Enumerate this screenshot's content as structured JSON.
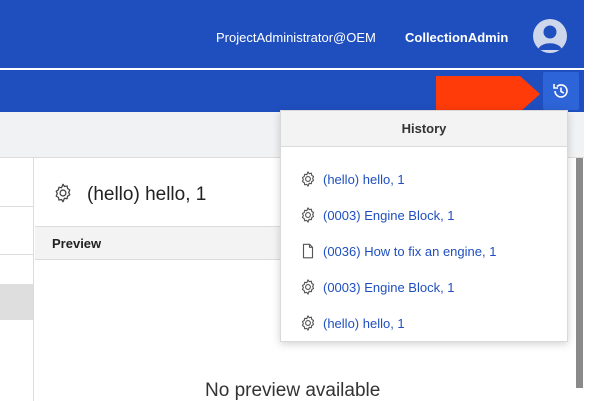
{
  "header": {
    "user": "ProjectAdministrator@OEM",
    "role": "CollectionAdmin",
    "bar_color": "#1f4fbf",
    "avatar_icon": "user-avatar-icon"
  },
  "toolbar": {
    "history_icon": "history-icon",
    "annotation_color": "#ff3b0a"
  },
  "content": {
    "title": "(hello) hello, 1",
    "title_icon": "gear-icon",
    "preview_label": "Preview",
    "no_preview_text": "No preview available"
  },
  "history": {
    "title": "History",
    "items": [
      {
        "label": "(hello) hello, 1",
        "icon": "gear-icon"
      },
      {
        "label": "(0003) Engine Block, 1",
        "icon": "gear-icon"
      },
      {
        "label": "(0036) How to fix an engine, 1",
        "icon": "document-icon"
      },
      {
        "label": "(0003) Engine Block, 1",
        "icon": "gear-icon"
      },
      {
        "label": "(hello) hello, 1",
        "icon": "gear-icon"
      }
    ]
  }
}
